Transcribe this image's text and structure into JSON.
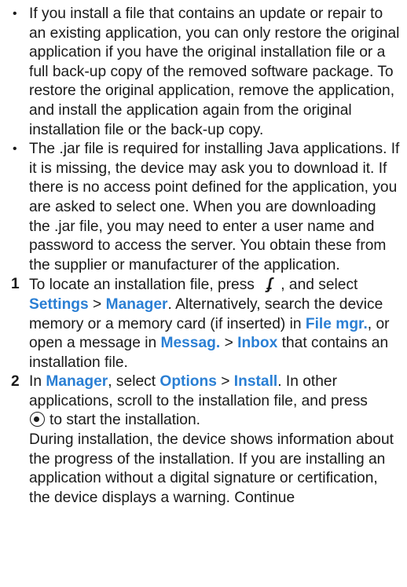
{
  "bullets": [
    "If you install a file that contains an update or repair to an existing application, you can only restore the original application if you have the original installation file or a full back-up copy of the removed software package. To restore the original application, remove the application, and install the application again from the original installation file or the back-up copy.",
    "The .jar file is required for installing Java applications. If it is missing, the device may ask you to download it. If there is no access point defined for the application, you are asked to select one. When you are downloading the .jar file, you may need to enter a user name and password to access the server. You obtain these from the supplier or manufacturer of the application."
  ],
  "steps": [
    {
      "number": "1",
      "t1": "To locate an installation file, press",
      "t2": ", and select",
      "settings": "Settings",
      "sep": ">",
      "manager": "Manager",
      "t3": ". Alternatively, search the device memory or a memory card (if inserted) in",
      "filemgr": "File mgr.",
      "t4": ", or open a message in",
      "messag": "Messag.",
      "inbox": "Inbox",
      "t5": "that contains an installation file."
    },
    {
      "number": "2",
      "t1": "In",
      "manager": "Manager",
      "t2": ", select",
      "options": "Options",
      "sep": ">",
      "install": "Install",
      "t3": ". In other applications, scroll to the installation file, and press",
      "t4": "to start the installation.",
      "t5": "During installation, the device shows information about the progress of the installation. If you are installing an application without a digital signature or certification, the device displays a warning. Continue"
    }
  ],
  "icons": {
    "menu_key": "menu-key-icon",
    "select_key": "select-key-icon"
  },
  "colors": {
    "highlight": "#2a7fd4",
    "text": "#1a1a1a"
  }
}
